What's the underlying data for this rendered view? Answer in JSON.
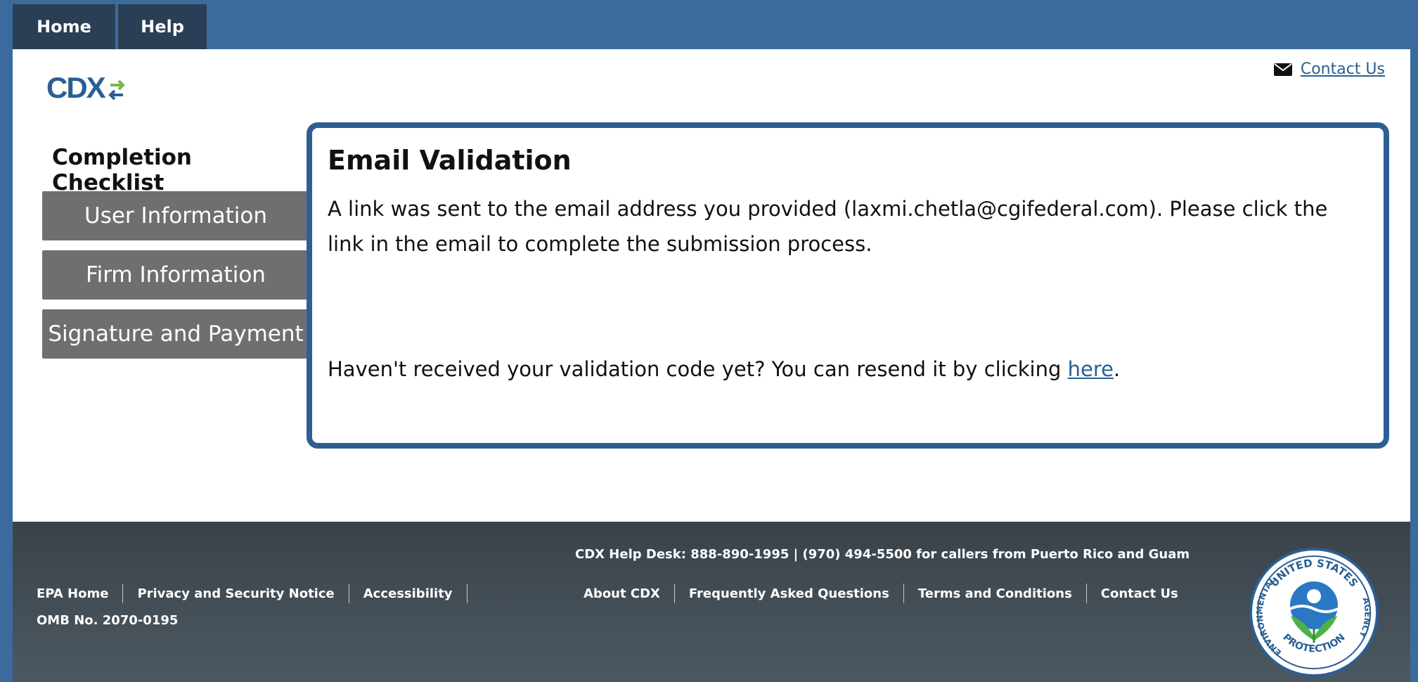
{
  "nav": {
    "home": "Home",
    "help": "Help"
  },
  "header": {
    "logo": "CDX",
    "contact": "Contact Us"
  },
  "sidebar": {
    "title": "Completion Checklist",
    "items": [
      {
        "label": "User Information"
      },
      {
        "label": "Firm Information"
      },
      {
        "label": "Signature and Payment"
      }
    ]
  },
  "panel": {
    "title": "Email Validation",
    "message": "A link was sent to the email address you provided (laxmi.chetla@cgifederal.com). Please click the link in the email to complete the submission process.",
    "resend_prefix": "Haven't received your validation code yet? You can resend it by clicking ",
    "resend_link": "here",
    "resend_suffix": "."
  },
  "footer": {
    "helpdesk": "CDX Help Desk: 888-890-1995 | (970) 494-5500 for callers from Puerto Rico and Guam",
    "left_links": [
      "EPA Home",
      "Privacy and Security Notice",
      "Accessibility"
    ],
    "center_links": [
      "About CDX",
      "Frequently Asked Questions",
      "Terms and Conditions",
      "Contact Us"
    ],
    "omb": "OMB No. 2070-0195",
    "seal_top": "UNITED STATES",
    "seal_left": "ENVIRONMENTAL",
    "seal_right": "AGENCY",
    "seal_bottom": "PROTECTION"
  },
  "colors": {
    "nav": "#3a6b9c",
    "tab": "#2a3f56",
    "accent": "#2e5f93",
    "button": "#6f6f6f",
    "link": "#2a5f92"
  }
}
